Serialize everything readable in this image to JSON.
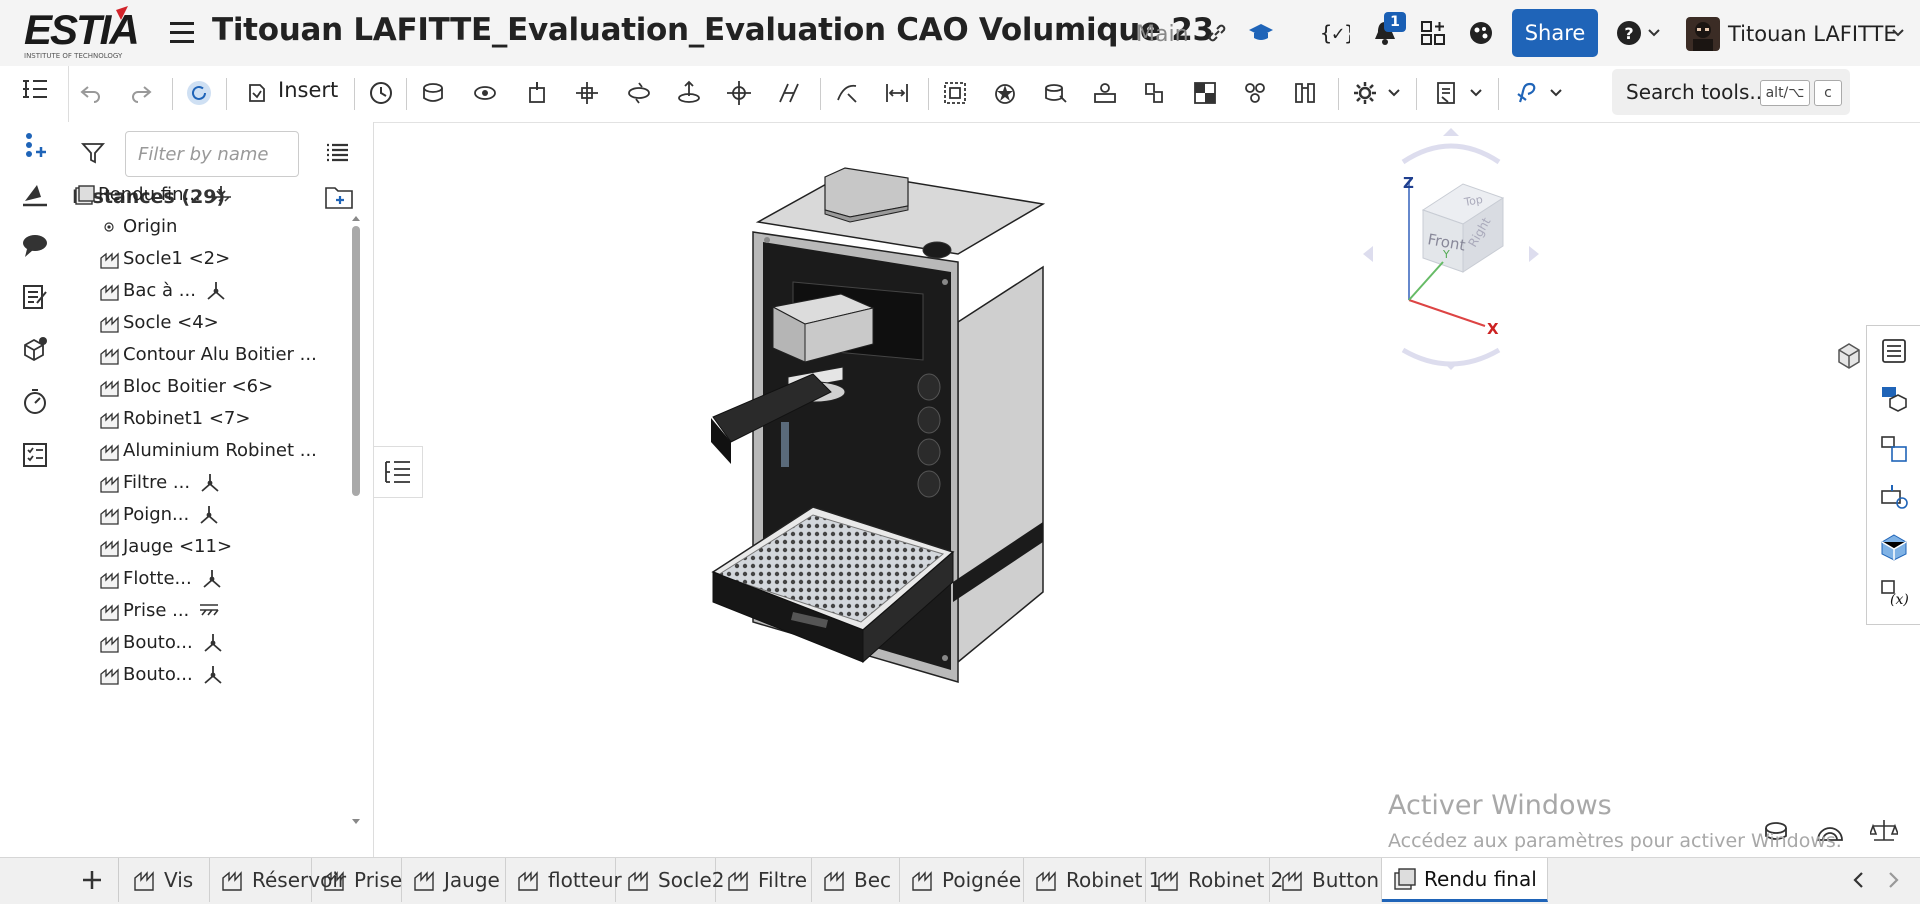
{
  "header": {
    "logo_text": "ESTIA",
    "logo_subtitle": "INSTITUTE OF TECHNOLOGY",
    "document_title": "Titouan LAFITTE_Evaluation_Evaluation CAO Volumique 23",
    "branch": "Main",
    "notification_count": "1",
    "share_label": "Share",
    "help_label": "?",
    "user_name": "Titouan LAFITTE"
  },
  "toolbar": {
    "insert_label": "Insert",
    "search_label": "Search tools...",
    "shortcut_1": "alt/⌥",
    "shortcut_2": "c"
  },
  "panel": {
    "filter_placeholder": "Filter by name",
    "instances_title": "Instances (29)",
    "items": [
      {
        "label": "Rendu fin...",
        "icon": "assembly-icon",
        "ext": "ground-icon"
      },
      {
        "label": "Origin",
        "icon": "origin-icon",
        "ext": ""
      },
      {
        "label": "Socle1 <2>",
        "icon": "part-instance-icon",
        "ext": ""
      },
      {
        "label": "Bac à ...",
        "icon": "part-instance-icon",
        "ext": "mate-icon"
      },
      {
        "label": "Socle <4>",
        "icon": "part-instance-icon",
        "ext": ""
      },
      {
        "label": "Contour Alu Boitier ...",
        "icon": "part-instance-icon",
        "ext": ""
      },
      {
        "label": "Bloc Boitier <6>",
        "icon": "part-instance-icon",
        "ext": ""
      },
      {
        "label": "Robinet1 <7>",
        "icon": "part-instance-icon",
        "ext": ""
      },
      {
        "label": "Aluminium Robinet ...",
        "icon": "part-instance-icon",
        "ext": ""
      },
      {
        "label": "Filtre ...",
        "icon": "part-instance-icon",
        "ext": "mate-icon"
      },
      {
        "label": "Poign...",
        "icon": "part-instance-icon",
        "ext": "mate-icon"
      },
      {
        "label": "Jauge <11>",
        "icon": "part-instance-icon",
        "ext": ""
      },
      {
        "label": "Flotte...",
        "icon": "part-instance-icon",
        "ext": "mate-icon"
      },
      {
        "label": "Prise ...",
        "icon": "part-instance-icon",
        "ext": "fixed-icon"
      },
      {
        "label": "Bouto...",
        "icon": "part-instance-icon",
        "ext": "mate-icon"
      },
      {
        "label": "Bouto...",
        "icon": "part-instance-icon",
        "ext": "mate-icon"
      }
    ]
  },
  "viewcube": {
    "top": "Top",
    "front": "Front",
    "right": "Right",
    "axis_x": "X",
    "axis_y": "Y",
    "axis_z": "Z"
  },
  "watermark": {
    "line1": "Activer Windows",
    "line2": "Accédez aux paramètres pour activer Windows."
  },
  "tabs": [
    {
      "label": "Vis",
      "active": false
    },
    {
      "label": "Réservoir",
      "active": false
    },
    {
      "label": "Prise",
      "active": false
    },
    {
      "label": "Jauge",
      "active": false
    },
    {
      "label": "flotteur",
      "active": false
    },
    {
      "label": "Socle2",
      "active": false
    },
    {
      "label": "Filtre",
      "active": false
    },
    {
      "label": "Bec",
      "active": false
    },
    {
      "label": "Poignée",
      "active": false
    },
    {
      "label": "Robinet 1",
      "active": false
    },
    {
      "label": "Robinet 2",
      "active": false
    },
    {
      "label": "Button",
      "active": false
    },
    {
      "label": "Rendu final",
      "active": true
    }
  ],
  "colors": {
    "accent": "#1f64b8",
    "logo_red": "#d2232a"
  }
}
